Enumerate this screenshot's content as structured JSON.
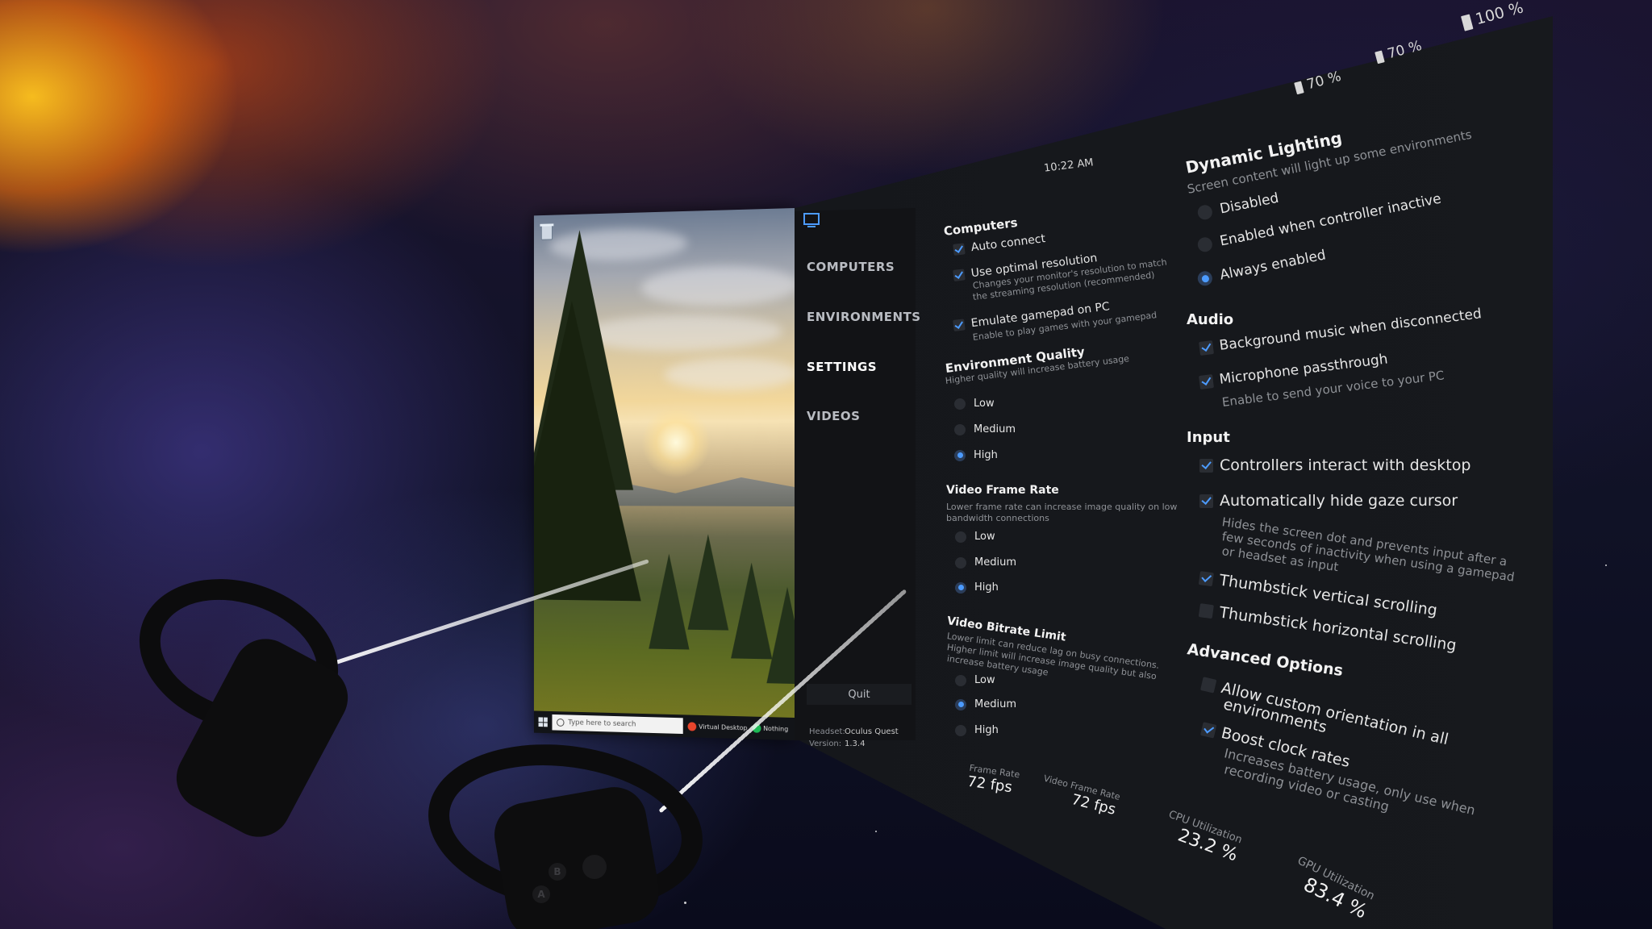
{
  "desktop": {
    "recycle_label": "Recycle Bin",
    "search_placeholder": "Type here to search",
    "taskbar_apps": [
      "Virtual Desktop",
      "Nothing"
    ]
  },
  "sidebar": {
    "items": [
      {
        "label": "COMPUTERS"
      },
      {
        "label": "ENVIRONMENTS"
      },
      {
        "label": "SETTINGS"
      },
      {
        "label": "VIDEOS"
      }
    ],
    "active": "SETTINGS",
    "quit_label": "Quit",
    "headset_key": "Headset:",
    "headset_value": "Oculus Quest",
    "version_key": "Version:",
    "version_value": "1.3.4"
  },
  "status": {
    "clock": "10:22 AM",
    "controller_left": "70 %",
    "controller_right": "70 %",
    "headset": "100 %"
  },
  "computers": {
    "title": "Computers",
    "auto_connect": "Auto connect",
    "optimal_resolution": "Use optimal resolution",
    "optimal_resolution_desc1": "Changes your monitor's resolution to match",
    "optimal_resolution_desc2": "the streaming resolution (recommended)",
    "emulate_gamepad": "Emulate gamepad on PC",
    "emulate_gamepad_desc": "Enable to play games with your gamepad"
  },
  "environment_quality": {
    "title": "Environment Quality",
    "desc": "Higher quality will increase battery usage",
    "options": [
      "Low",
      "Medium",
      "High"
    ],
    "selected": "High"
  },
  "video_frame_rate": {
    "title": "Video Frame Rate",
    "desc1": "Lower frame rate can increase image quality on low",
    "desc2": "bandwidth connections",
    "options": [
      "Low",
      "Medium",
      "High"
    ],
    "selected": "High"
  },
  "video_bitrate": {
    "title": "Video Bitrate Limit",
    "desc1": "Lower limit can reduce lag on busy connections.",
    "desc2": "Higher limit will increase image quality but also",
    "desc3": "increase battery usage",
    "options": [
      "Low",
      "Medium",
      "High"
    ],
    "selected": "Medium"
  },
  "dynamic_lighting": {
    "title": "Dynamic Lighting",
    "desc": "Screen content will light up some environments",
    "options": [
      "Disabled",
      "Enabled when controller inactive",
      "Always enabled"
    ],
    "selected": "Always enabled"
  },
  "audio": {
    "title": "Audio",
    "background_music": "Background music when disconnected",
    "mic_passthrough": "Microphone passthrough",
    "mic_passthrough_desc": "Enable to send your voice to your PC"
  },
  "input": {
    "title": "Input",
    "controllers_interact": "Controllers interact with desktop",
    "hide_gaze": "Automatically hide gaze cursor",
    "hide_gaze_desc1": "Hides the screen dot and prevents input after a",
    "hide_gaze_desc2": "few seconds of inactivity when using a gamepad",
    "hide_gaze_desc3": "or headset as input",
    "thumb_vertical": "Thumbstick vertical scrolling",
    "thumb_horizontal": "Thumbstick horizontal scrolling"
  },
  "advanced": {
    "title": "Advanced Options",
    "custom_orientation1": "Allow custom orientation in all",
    "custom_orientation2": "environments",
    "boost_clock": "Boost clock rates",
    "boost_clock_desc1": "Increases battery usage, only use when",
    "boost_clock_desc2": "recording video or casting"
  },
  "stats": {
    "frame_rate_label": "Frame Rate",
    "frame_rate_value": "72 fps",
    "video_frame_rate_label": "Video Frame Rate",
    "video_frame_rate_value": "72 fps",
    "cpu_label": "CPU Utilization",
    "cpu_value": "23.2 %",
    "gpu_label": "GPU Utilization",
    "gpu_value": "83.4 %"
  },
  "colors": {
    "accent": "#4c9bff",
    "panel": "#16181c"
  },
  "icons": [
    "monitor-icon",
    "checkbox-icon",
    "radio-icon",
    "battery-icon",
    "windows-icon"
  ]
}
